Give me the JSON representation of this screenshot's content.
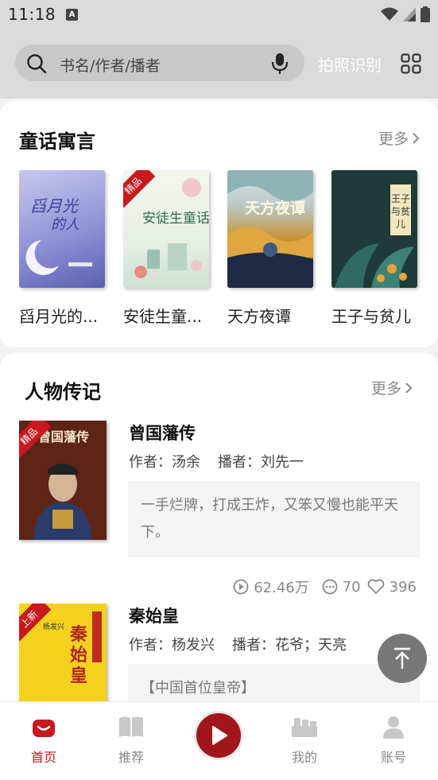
{
  "status": {
    "time": "11:18",
    "notif_glyph": "A"
  },
  "search": {
    "placeholder": "书名/作者/播者",
    "photo_label": "拍照识别"
  },
  "section_fairy": {
    "title": "童话寓言",
    "more": "更多",
    "books": [
      {
        "title": "舀月光的...",
        "cover_text": "舀月光的人",
        "badge": ""
      },
      {
        "title": "安徒生童...",
        "cover_text": "安徒生童话",
        "badge": "精品"
      },
      {
        "title": "天方夜谭",
        "cover_text": "天方夜谭",
        "badge": ""
      },
      {
        "title": "王子与贫儿",
        "cover_text": "王子与贫儿",
        "badge": ""
      }
    ]
  },
  "section_bio": {
    "title": "人物传记",
    "more": "更多",
    "items": [
      {
        "name": "曾国藩传",
        "author_label": "作者：汤余",
        "narrator_label": "播者：刘先一",
        "desc": "一手烂牌，打成王炸，又笨又慢也能平天下。",
        "badge": "精品",
        "cover_text": "曾国藩传",
        "plays": "62.46万",
        "comments": "70",
        "likes": "396"
      },
      {
        "name": "秦始皇",
        "author_label": "作者：杨发兴",
        "narrator_label": "播者：花爷；天亮",
        "desc": "【中国首位皇帝】",
        "badge": "上新",
        "cover_text": "秦始皇"
      }
    ]
  },
  "nav": {
    "home": "首页",
    "recommend": "推荐",
    "mine": "我的",
    "account": "账号"
  },
  "colors": {
    "accent": "#c8191e",
    "play": "#a2161b"
  }
}
